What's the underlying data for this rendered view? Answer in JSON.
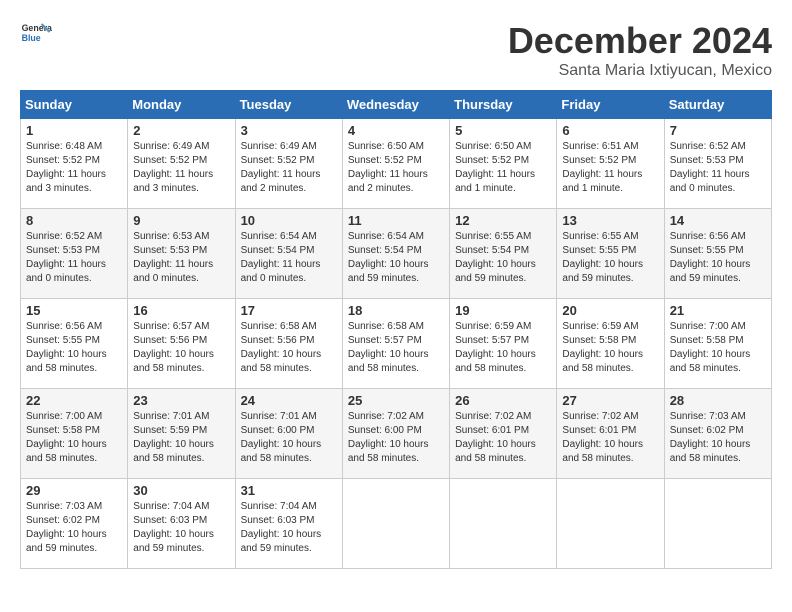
{
  "logo": {
    "line1": "General",
    "line2": "Blue"
  },
  "title": "December 2024",
  "location": "Santa Maria Ixtiyucan, Mexico",
  "headers": [
    "Sunday",
    "Monday",
    "Tuesday",
    "Wednesday",
    "Thursday",
    "Friday",
    "Saturday"
  ],
  "weeks": [
    [
      {
        "day": "1",
        "sunrise": "6:48 AM",
        "sunset": "5:52 PM",
        "daylight": "11 hours and 3 minutes."
      },
      {
        "day": "2",
        "sunrise": "6:49 AM",
        "sunset": "5:52 PM",
        "daylight": "11 hours and 3 minutes."
      },
      {
        "day": "3",
        "sunrise": "6:49 AM",
        "sunset": "5:52 PM",
        "daylight": "11 hours and 2 minutes."
      },
      {
        "day": "4",
        "sunrise": "6:50 AM",
        "sunset": "5:52 PM",
        "daylight": "11 hours and 2 minutes."
      },
      {
        "day": "5",
        "sunrise": "6:50 AM",
        "sunset": "5:52 PM",
        "daylight": "11 hours and 1 minute."
      },
      {
        "day": "6",
        "sunrise": "6:51 AM",
        "sunset": "5:52 PM",
        "daylight": "11 hours and 1 minute."
      },
      {
        "day": "7",
        "sunrise": "6:52 AM",
        "sunset": "5:53 PM",
        "daylight": "11 hours and 0 minutes."
      }
    ],
    [
      {
        "day": "8",
        "sunrise": "6:52 AM",
        "sunset": "5:53 PM",
        "daylight": "11 hours and 0 minutes."
      },
      {
        "day": "9",
        "sunrise": "6:53 AM",
        "sunset": "5:53 PM",
        "daylight": "11 hours and 0 minutes."
      },
      {
        "day": "10",
        "sunrise": "6:54 AM",
        "sunset": "5:54 PM",
        "daylight": "11 hours and 0 minutes."
      },
      {
        "day": "11",
        "sunrise": "6:54 AM",
        "sunset": "5:54 PM",
        "daylight": "10 hours and 59 minutes."
      },
      {
        "day": "12",
        "sunrise": "6:55 AM",
        "sunset": "5:54 PM",
        "daylight": "10 hours and 59 minutes."
      },
      {
        "day": "13",
        "sunrise": "6:55 AM",
        "sunset": "5:55 PM",
        "daylight": "10 hours and 59 minutes."
      },
      {
        "day": "14",
        "sunrise": "6:56 AM",
        "sunset": "5:55 PM",
        "daylight": "10 hours and 59 minutes."
      }
    ],
    [
      {
        "day": "15",
        "sunrise": "6:56 AM",
        "sunset": "5:55 PM",
        "daylight": "10 hours and 58 minutes."
      },
      {
        "day": "16",
        "sunrise": "6:57 AM",
        "sunset": "5:56 PM",
        "daylight": "10 hours and 58 minutes."
      },
      {
        "day": "17",
        "sunrise": "6:58 AM",
        "sunset": "5:56 PM",
        "daylight": "10 hours and 58 minutes."
      },
      {
        "day": "18",
        "sunrise": "6:58 AM",
        "sunset": "5:57 PM",
        "daylight": "10 hours and 58 minutes."
      },
      {
        "day": "19",
        "sunrise": "6:59 AM",
        "sunset": "5:57 PM",
        "daylight": "10 hours and 58 minutes."
      },
      {
        "day": "20",
        "sunrise": "6:59 AM",
        "sunset": "5:58 PM",
        "daylight": "10 hours and 58 minutes."
      },
      {
        "day": "21",
        "sunrise": "7:00 AM",
        "sunset": "5:58 PM",
        "daylight": "10 hours and 58 minutes."
      }
    ],
    [
      {
        "day": "22",
        "sunrise": "7:00 AM",
        "sunset": "5:58 PM",
        "daylight": "10 hours and 58 minutes."
      },
      {
        "day": "23",
        "sunrise": "7:01 AM",
        "sunset": "5:59 PM",
        "daylight": "10 hours and 58 minutes."
      },
      {
        "day": "24",
        "sunrise": "7:01 AM",
        "sunset": "6:00 PM",
        "daylight": "10 hours and 58 minutes."
      },
      {
        "day": "25",
        "sunrise": "7:02 AM",
        "sunset": "6:00 PM",
        "daylight": "10 hours and 58 minutes."
      },
      {
        "day": "26",
        "sunrise": "7:02 AM",
        "sunset": "6:01 PM",
        "daylight": "10 hours and 58 minutes."
      },
      {
        "day": "27",
        "sunrise": "7:02 AM",
        "sunset": "6:01 PM",
        "daylight": "10 hours and 58 minutes."
      },
      {
        "day": "28",
        "sunrise": "7:03 AM",
        "sunset": "6:02 PM",
        "daylight": "10 hours and 58 minutes."
      }
    ],
    [
      {
        "day": "29",
        "sunrise": "7:03 AM",
        "sunset": "6:02 PM",
        "daylight": "10 hours and 59 minutes."
      },
      {
        "day": "30",
        "sunrise": "7:04 AM",
        "sunset": "6:03 PM",
        "daylight": "10 hours and 59 minutes."
      },
      {
        "day": "31",
        "sunrise": "7:04 AM",
        "sunset": "6:03 PM",
        "daylight": "10 hours and 59 minutes."
      },
      null,
      null,
      null,
      null
    ]
  ],
  "labels": {
    "sunrise": "Sunrise:",
    "sunset": "Sunset:",
    "daylight": "Daylight:"
  },
  "colors": {
    "header_bg": "#2a6db5",
    "even_row": "#f5f5f5"
  }
}
